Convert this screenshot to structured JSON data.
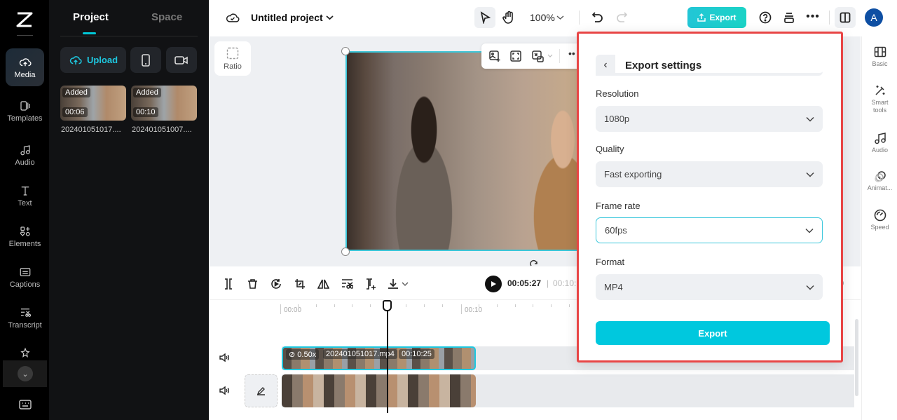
{
  "nav": {
    "items": [
      {
        "id": "media",
        "label": "Media",
        "icon": "cloud-upload-icon",
        "active": true
      },
      {
        "id": "templates",
        "label": "Templates",
        "icon": "templates-icon"
      },
      {
        "id": "audio",
        "label": "Audio",
        "icon": "music-note-icon"
      },
      {
        "id": "text",
        "label": "Text",
        "icon": "text-icon"
      },
      {
        "id": "elements",
        "label": "Elements",
        "icon": "elements-icon"
      },
      {
        "id": "captions",
        "label": "Captions",
        "icon": "captions-icon"
      },
      {
        "id": "transcript",
        "label": "Transcript",
        "icon": "transcript-icon"
      },
      {
        "id": "effects",
        "label": "Effects",
        "icon": "effects-icon"
      }
    ],
    "more_icon": "chevron-down-icon",
    "keyboard_icon": "keyboard-icon"
  },
  "panel": {
    "tabs": [
      {
        "label": "Project",
        "active": true
      },
      {
        "label": "Space",
        "active": false
      }
    ],
    "upload_label": "Upload",
    "media": [
      {
        "badge": "Added",
        "duration": "00:06",
        "name": "202401051017...."
      },
      {
        "badge": "Added",
        "duration": "00:10",
        "name": "202401051007...."
      }
    ]
  },
  "topbar": {
    "project_title": "Untitled project",
    "zoom": "100%",
    "export_label": "Export",
    "avatar_letter": "A"
  },
  "canvas": {
    "ratio_label": "Ratio"
  },
  "right_sidebar": {
    "items": [
      {
        "label": "Basic",
        "icon": "film-icon"
      },
      {
        "label": "Smart tools",
        "icon": "magic-wand-icon"
      },
      {
        "label": "Audio",
        "icon": "music-note-icon"
      },
      {
        "label": "Animat...",
        "icon": "animation-icon"
      },
      {
        "label": "Speed",
        "icon": "speedometer-icon"
      }
    ]
  },
  "timeline": {
    "current_time": "00:05:27",
    "separator": "|",
    "total_time": "00:10:",
    "ruler": [
      "00:00",
      "00:10"
    ],
    "clip1": {
      "speed": "0.50x",
      "name": "202401051017.mp4",
      "duration": "00:10:25"
    }
  },
  "export_dialog": {
    "title": "Export settings",
    "fields": [
      {
        "label": "Resolution",
        "value": "1080p"
      },
      {
        "label": "Quality",
        "value": "Fast exporting"
      },
      {
        "label": "Frame rate",
        "value": "60fps",
        "focused": true
      },
      {
        "label": "Format",
        "value": "MP4"
      }
    ],
    "export_label": "Export"
  },
  "colors": {
    "accent": "#00c8de",
    "highlight_border": "#e84545",
    "avatar": "#0e4fa3"
  }
}
